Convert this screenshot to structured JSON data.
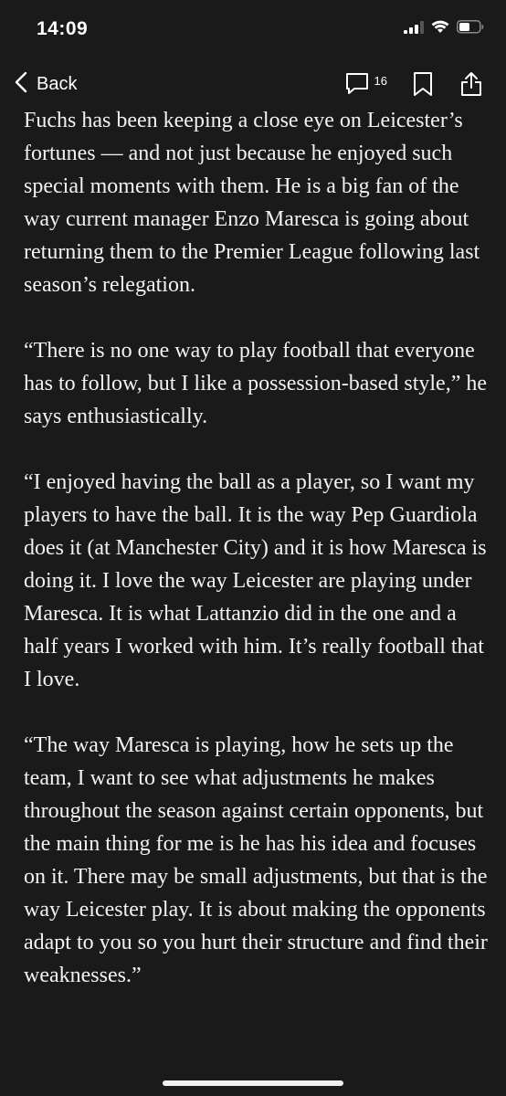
{
  "status_bar": {
    "time": "14:09",
    "icons": [
      "cellular-signal-icon",
      "wifi-icon",
      "battery-icon"
    ]
  },
  "nav": {
    "back_label": "Back",
    "comment_count": "16",
    "icons": [
      "chevron-left-icon",
      "comment-icon",
      "bookmark-icon",
      "share-icon"
    ]
  },
  "article": {
    "paragraphs": [
      "Fuchs has been keeping a close eye on Leicester’s fortunes — and not just because he enjoyed such special moments with them. He is a big fan of the way current manager Enzo Maresca is going about returning them to the Premier League following last season’s relegation.",
      "“There is no one way to play football that everyone has to follow, but I like a possession-based style,” he says enthusiastically.",
      "“I enjoyed having the ball as a player, so I want my players to have the ball. It is the way Pep Guardiola does it (at Manchester City) and it is how Maresca is doing it. I love the way Leicester are playing under Maresca. It is what Lattanzio did in the one and a half years I worked with him. It’s really football that I love.",
      "“The way Maresca is playing, how he sets up the team, I want to see what adjustments he makes throughout the season against certain opponents, but the main thing for me is he has his idea and focuses on it. There may be small adjustments, but that is the way Leicester play. It is about making the opponents adapt to you so you hurt their structure and find their weaknesses.”"
    ]
  },
  "colors": {
    "background": "#1a1a1a",
    "text": "#f2f2f2"
  }
}
